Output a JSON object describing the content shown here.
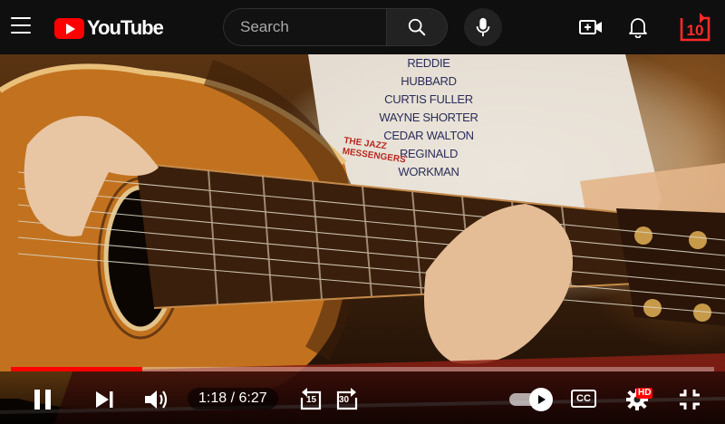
{
  "masthead": {
    "logo_text": "YouTube",
    "search_placeholder": "Search",
    "icons": [
      "menu-icon",
      "youtube-logo",
      "search-icon",
      "microphone-icon",
      "create-video-icon",
      "notifications-bell-icon",
      "replay-10-icon"
    ],
    "replay_label": "10",
    "accent_color": "#ff0000"
  },
  "video": {
    "shirt_lines": [
      "REDDIE HUBBARD",
      "CURTIS FULLER",
      "WAYNE SHORTER",
      "CEDAR WALTON",
      "REGINALD WORKMAN"
    ],
    "shirt_album": "THE JAZZ MESSENGERS"
  },
  "player": {
    "progress_fraction": 0.187,
    "current_time": "1:18",
    "duration": "6:27",
    "time_display": "1:18 / 6:27",
    "skip_back_label": "15",
    "skip_forward_label": "30",
    "cc_label": "CC",
    "hd_label": "HD",
    "autoplay_on": true,
    "progress_color": "#ff0000"
  }
}
